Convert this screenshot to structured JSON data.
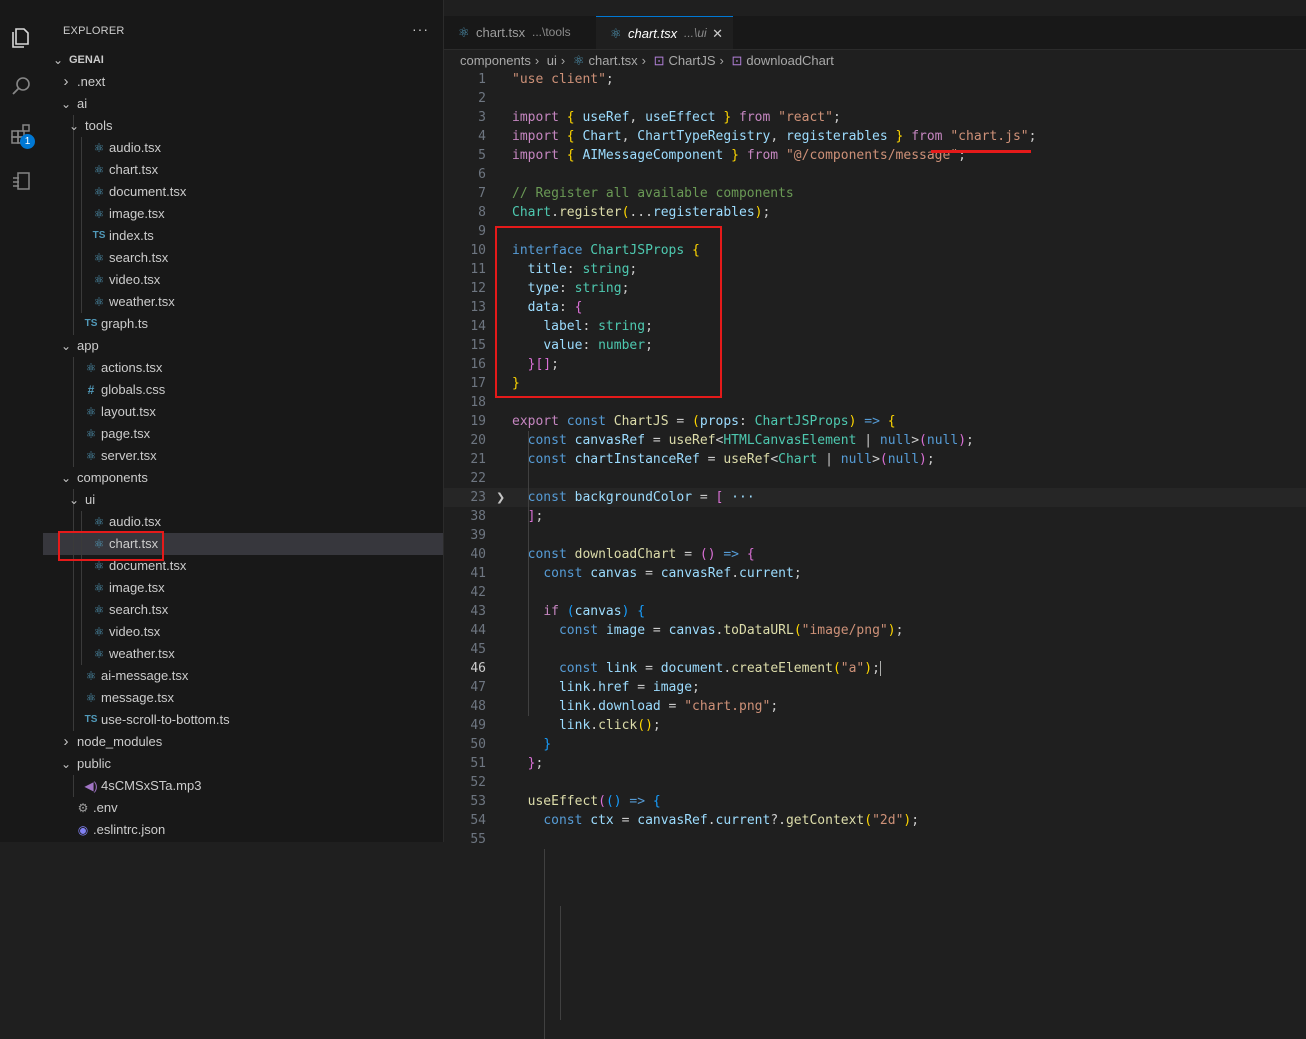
{
  "explorer": {
    "header": "EXPLORER",
    "more": "···",
    "badge": "1",
    "rows": [
      {
        "label": "GENAI",
        "depth": 0,
        "type": "root"
      },
      {
        "label": ".next",
        "depth": 1,
        "type": "folder-closed"
      },
      {
        "label": "ai",
        "depth": 1,
        "type": "folder-open"
      },
      {
        "label": "tools",
        "depth": 2,
        "type": "folder-open"
      },
      {
        "label": "audio.tsx",
        "depth": 3,
        "type": "react"
      },
      {
        "label": "chart.tsx",
        "depth": 3,
        "type": "react"
      },
      {
        "label": "document.tsx",
        "depth": 3,
        "type": "react"
      },
      {
        "label": "image.tsx",
        "depth": 3,
        "type": "react"
      },
      {
        "label": "index.ts",
        "depth": 3,
        "type": "ts"
      },
      {
        "label": "search.tsx",
        "depth": 3,
        "type": "react"
      },
      {
        "label": "video.tsx",
        "depth": 3,
        "type": "react"
      },
      {
        "label": "weather.tsx",
        "depth": 3,
        "type": "react"
      },
      {
        "label": "graph.ts",
        "depth": 2,
        "type": "ts"
      },
      {
        "label": "app",
        "depth": 1,
        "type": "folder-open"
      },
      {
        "label": "actions.tsx",
        "depth": 2,
        "type": "react"
      },
      {
        "label": "globals.css",
        "depth": 2,
        "type": "css"
      },
      {
        "label": "layout.tsx",
        "depth": 2,
        "type": "react"
      },
      {
        "label": "page.tsx",
        "depth": 2,
        "type": "react"
      },
      {
        "label": "server.tsx",
        "depth": 2,
        "type": "react"
      },
      {
        "label": "components",
        "depth": 1,
        "type": "folder-open"
      },
      {
        "label": "ui",
        "depth": 2,
        "type": "folder-open"
      },
      {
        "label": "audio.tsx",
        "depth": 3,
        "type": "react"
      },
      {
        "label": "chart.tsx",
        "depth": 3,
        "type": "react",
        "selected": true
      },
      {
        "label": "document.tsx",
        "depth": 3,
        "type": "react"
      },
      {
        "label": "image.tsx",
        "depth": 3,
        "type": "react"
      },
      {
        "label": "search.tsx",
        "depth": 3,
        "type": "react"
      },
      {
        "label": "video.tsx",
        "depth": 3,
        "type": "react"
      },
      {
        "label": "weather.tsx",
        "depth": 3,
        "type": "react"
      },
      {
        "label": "ai-message.tsx",
        "depth": 2,
        "type": "react"
      },
      {
        "label": "message.tsx",
        "depth": 2,
        "type": "react"
      },
      {
        "label": "use-scroll-to-bottom.ts",
        "depth": 2,
        "type": "ts"
      },
      {
        "label": "node_modules",
        "depth": 1,
        "type": "folder-closed"
      },
      {
        "label": "public",
        "depth": 1,
        "type": "folder-open"
      },
      {
        "label": "4sCMSxSTa.mp3",
        "depth": 2,
        "type": "mp3"
      },
      {
        "label": ".env",
        "depth": 1,
        "type": "env"
      },
      {
        "label": ".eslintrc.json",
        "depth": 1,
        "type": "eslint"
      }
    ]
  },
  "tabs": [
    {
      "name": "chart.tsx",
      "desc": "...\\tools",
      "active": false
    },
    {
      "name": "chart.tsx",
      "desc": "...\\ui",
      "active": true,
      "close": "✕"
    }
  ],
  "breadcrumb": [
    "components",
    "ui",
    "chart.tsx",
    "ChartJS",
    "downloadChart"
  ],
  "code_lines": [
    {
      "n": "1",
      "tokens": [
        [
          "s",
          "\"use client\""
        ],
        [
          "p",
          ";"
        ]
      ]
    },
    {
      "n": "2",
      "tokens": []
    },
    {
      "n": "3",
      "tokens": [
        [
          "c",
          "import"
        ],
        [
          "p",
          " "
        ],
        [
          "b1",
          "{"
        ],
        [
          "p",
          " "
        ],
        [
          "v",
          "useRef"
        ],
        [
          "p",
          ", "
        ],
        [
          "v",
          "useEffect"
        ],
        [
          "p",
          " "
        ],
        [
          "b1",
          "}"
        ],
        [
          "p",
          " "
        ],
        [
          "c",
          "from"
        ],
        [
          "p",
          " "
        ],
        [
          "s",
          "\"react\""
        ],
        [
          "p",
          ";"
        ]
      ]
    },
    {
      "n": "4",
      "tokens": [
        [
          "c",
          "import"
        ],
        [
          "p",
          " "
        ],
        [
          "b1",
          "{"
        ],
        [
          "p",
          " "
        ],
        [
          "v",
          "Chart"
        ],
        [
          "p",
          ", "
        ],
        [
          "v",
          "ChartTypeRegistry"
        ],
        [
          "p",
          ", "
        ],
        [
          "v",
          "registerables"
        ],
        [
          "p",
          " "
        ],
        [
          "b1",
          "}"
        ],
        [
          "p",
          " "
        ],
        [
          "c",
          "from"
        ],
        [
          "p",
          " "
        ],
        [
          "s",
          "\"chart.js\""
        ],
        [
          "p",
          ";"
        ]
      ]
    },
    {
      "n": "5",
      "tokens": [
        [
          "c",
          "import"
        ],
        [
          "p",
          " "
        ],
        [
          "b1",
          "{"
        ],
        [
          "p",
          " "
        ],
        [
          "v",
          "AIMessageComponent"
        ],
        [
          "p",
          " "
        ],
        [
          "b1",
          "}"
        ],
        [
          "p",
          " "
        ],
        [
          "c",
          "from"
        ],
        [
          "p",
          " "
        ],
        [
          "s",
          "\"@/components/message\""
        ],
        [
          "p",
          ";"
        ]
      ]
    },
    {
      "n": "6",
      "tokens": []
    },
    {
      "n": "7",
      "tokens": [
        [
          "cm",
          "// Register all available components"
        ]
      ]
    },
    {
      "n": "8",
      "tokens": [
        [
          "t",
          "Chart"
        ],
        [
          "p",
          "."
        ],
        [
          "f",
          "register"
        ],
        [
          "b1",
          "("
        ],
        [
          "p",
          "..."
        ],
        [
          "v",
          "registerables"
        ],
        [
          "b1",
          ")"
        ],
        [
          "p",
          ";"
        ]
      ]
    },
    {
      "n": "9",
      "tokens": []
    },
    {
      "n": "10",
      "tokens": [
        [
          "k",
          "interface"
        ],
        [
          "p",
          " "
        ],
        [
          "t",
          "ChartJSProps"
        ],
        [
          "p",
          " "
        ],
        [
          "b1",
          "{"
        ]
      ]
    },
    {
      "n": "11",
      "tokens": [
        [
          "p",
          "  "
        ],
        [
          "v",
          "title"
        ],
        [
          "p",
          ": "
        ],
        [
          "t",
          "string"
        ],
        [
          "p",
          ";"
        ]
      ]
    },
    {
      "n": "12",
      "tokens": [
        [
          "p",
          "  "
        ],
        [
          "v",
          "type"
        ],
        [
          "p",
          ": "
        ],
        [
          "t",
          "string"
        ],
        [
          "p",
          ";"
        ]
      ]
    },
    {
      "n": "13",
      "tokens": [
        [
          "p",
          "  "
        ],
        [
          "v",
          "data"
        ],
        [
          "p",
          ": "
        ],
        [
          "b2",
          "{"
        ]
      ]
    },
    {
      "n": "14",
      "tokens": [
        [
          "p",
          "    "
        ],
        [
          "v",
          "label"
        ],
        [
          "p",
          ": "
        ],
        [
          "t",
          "string"
        ],
        [
          "p",
          ";"
        ]
      ]
    },
    {
      "n": "15",
      "tokens": [
        [
          "p",
          "    "
        ],
        [
          "v",
          "value"
        ],
        [
          "p",
          ": "
        ],
        [
          "t",
          "number"
        ],
        [
          "p",
          ";"
        ]
      ]
    },
    {
      "n": "16",
      "tokens": [
        [
          "p",
          "  "
        ],
        [
          "b2",
          "}"
        ],
        [
          "b2",
          "[]"
        ],
        [
          "p",
          ";"
        ]
      ]
    },
    {
      "n": "17",
      "tokens": [
        [
          "b1",
          "}"
        ]
      ]
    },
    {
      "n": "18",
      "tokens": []
    },
    {
      "n": "19",
      "tokens": [
        [
          "c",
          "export"
        ],
        [
          "p",
          " "
        ],
        [
          "k",
          "const"
        ],
        [
          "p",
          " "
        ],
        [
          "f",
          "ChartJS"
        ],
        [
          "p",
          " = "
        ],
        [
          "b1",
          "("
        ],
        [
          "v",
          "props"
        ],
        [
          "p",
          ": "
        ],
        [
          "t",
          "ChartJSProps"
        ],
        [
          "b1",
          ")"
        ],
        [
          "p",
          " "
        ],
        [
          "k",
          "=>"
        ],
        [
          "p",
          " "
        ],
        [
          "b1",
          "{"
        ]
      ]
    },
    {
      "n": "20",
      "tokens": [
        [
          "p",
          "  "
        ],
        [
          "k",
          "const"
        ],
        [
          "p",
          " "
        ],
        [
          "v",
          "canvasRef"
        ],
        [
          "p",
          " = "
        ],
        [
          "f",
          "useRef"
        ],
        [
          "p",
          "<"
        ],
        [
          "t",
          "HTMLCanvasElement"
        ],
        [
          "p",
          " | "
        ],
        [
          "k",
          "null"
        ],
        [
          "p",
          ">"
        ],
        [
          "b2",
          "("
        ],
        [
          "k",
          "null"
        ],
        [
          "b2",
          ")"
        ],
        [
          "p",
          ";"
        ]
      ]
    },
    {
      "n": "21",
      "tokens": [
        [
          "p",
          "  "
        ],
        [
          "k",
          "const"
        ],
        [
          "p",
          " "
        ],
        [
          "v",
          "chartInstanceRef"
        ],
        [
          "p",
          " = "
        ],
        [
          "f",
          "useRef"
        ],
        [
          "p",
          "<"
        ],
        [
          "t",
          "Chart"
        ],
        [
          "p",
          " | "
        ],
        [
          "k",
          "null"
        ],
        [
          "p",
          ">"
        ],
        [
          "b2",
          "("
        ],
        [
          "k",
          "null"
        ],
        [
          "b2",
          ")"
        ],
        [
          "p",
          ";"
        ]
      ]
    },
    {
      "n": "22",
      "tokens": []
    },
    {
      "n": "23",
      "tokens": [
        [
          "p",
          "  "
        ],
        [
          "k",
          "const"
        ],
        [
          "p",
          " "
        ],
        [
          "v",
          "backgroundColor"
        ],
        [
          "p",
          " = "
        ],
        [
          "b2",
          "["
        ],
        [
          "p",
          " "
        ],
        [
          "v",
          "···"
        ]
      ],
      "fold": "❯",
      "hl": true
    },
    {
      "n": "38",
      "tokens": [
        [
          "p",
          "  "
        ],
        [
          "b2",
          "]"
        ],
        [
          "p",
          ";"
        ]
      ]
    },
    {
      "n": "39",
      "tokens": []
    },
    {
      "n": "40",
      "tokens": [
        [
          "p",
          "  "
        ],
        [
          "k",
          "const"
        ],
        [
          "p",
          " "
        ],
        [
          "f",
          "downloadChart"
        ],
        [
          "p",
          " = "
        ],
        [
          "b2",
          "("
        ],
        [
          "b2",
          ")"
        ],
        [
          "p",
          " "
        ],
        [
          "k",
          "=>"
        ],
        [
          "p",
          " "
        ],
        [
          "b2",
          "{"
        ]
      ]
    },
    {
      "n": "41",
      "tokens": [
        [
          "p",
          "    "
        ],
        [
          "k",
          "const"
        ],
        [
          "p",
          " "
        ],
        [
          "v",
          "canvas"
        ],
        [
          "p",
          " = "
        ],
        [
          "v",
          "canvasRef"
        ],
        [
          "p",
          "."
        ],
        [
          "v",
          "current"
        ],
        [
          "p",
          ";"
        ]
      ]
    },
    {
      "n": "42",
      "tokens": []
    },
    {
      "n": "43",
      "tokens": [
        [
          "p",
          "    "
        ],
        [
          "c",
          "if"
        ],
        [
          "p",
          " "
        ],
        [
          "b3",
          "("
        ],
        [
          "v",
          "canvas"
        ],
        [
          "b3",
          ")"
        ],
        [
          "p",
          " "
        ],
        [
          "b3",
          "{"
        ]
      ]
    },
    {
      "n": "44",
      "tokens": [
        [
          "p",
          "      "
        ],
        [
          "k",
          "const"
        ],
        [
          "p",
          " "
        ],
        [
          "v",
          "image"
        ],
        [
          "p",
          " = "
        ],
        [
          "v",
          "canvas"
        ],
        [
          "p",
          "."
        ],
        [
          "f",
          "toDataURL"
        ],
        [
          "b1",
          "("
        ],
        [
          "s",
          "\"image/png\""
        ],
        [
          "b1",
          ")"
        ],
        [
          "p",
          ";"
        ]
      ]
    },
    {
      "n": "45",
      "tokens": []
    },
    {
      "n": "46",
      "tokens": [
        [
          "p",
          "      "
        ],
        [
          "k",
          "const"
        ],
        [
          "p",
          " "
        ],
        [
          "v",
          "link"
        ],
        [
          "p",
          " = "
        ],
        [
          "v",
          "document"
        ],
        [
          "p",
          "."
        ],
        [
          "f",
          "createElement"
        ],
        [
          "b1",
          "("
        ],
        [
          "s",
          "\"a\""
        ],
        [
          "b1",
          ")"
        ],
        [
          "p",
          ";"
        ]
      ],
      "active": true,
      "cursor": true
    },
    {
      "n": "47",
      "tokens": [
        [
          "p",
          "      "
        ],
        [
          "v",
          "link"
        ],
        [
          "p",
          "."
        ],
        [
          "v",
          "href"
        ],
        [
          "p",
          " = "
        ],
        [
          "v",
          "image"
        ],
        [
          "p",
          ";"
        ]
      ]
    },
    {
      "n": "48",
      "tokens": [
        [
          "p",
          "      "
        ],
        [
          "v",
          "link"
        ],
        [
          "p",
          "."
        ],
        [
          "v",
          "download"
        ],
        [
          "p",
          " = "
        ],
        [
          "s",
          "\"chart.png\""
        ],
        [
          "p",
          ";"
        ]
      ]
    },
    {
      "n": "49",
      "tokens": [
        [
          "p",
          "      "
        ],
        [
          "v",
          "link"
        ],
        [
          "p",
          "."
        ],
        [
          "f",
          "click"
        ],
        [
          "b1",
          "("
        ],
        [
          "b1",
          ")"
        ],
        [
          "p",
          ";"
        ]
      ]
    },
    {
      "n": "50",
      "tokens": [
        [
          "p",
          "    "
        ],
        [
          "b3",
          "}"
        ]
      ]
    },
    {
      "n": "51",
      "tokens": [
        [
          "p",
          "  "
        ],
        [
          "b2",
          "}"
        ],
        [
          "p",
          ";"
        ]
      ]
    },
    {
      "n": "52",
      "tokens": []
    },
    {
      "n": "53",
      "tokens": [
        [
          "p",
          "  "
        ],
        [
          "f",
          "useEffect"
        ],
        [
          "b2",
          "("
        ],
        [
          "b3",
          "("
        ],
        [
          "b3",
          ")"
        ],
        [
          "p",
          " "
        ],
        [
          "k",
          "=>"
        ],
        [
          "p",
          " "
        ],
        [
          "b3",
          "{"
        ]
      ]
    },
    {
      "n": "54",
      "tokens": [
        [
          "p",
          "    "
        ],
        [
          "k",
          "const"
        ],
        [
          "p",
          " "
        ],
        [
          "v",
          "ctx"
        ],
        [
          "p",
          " = "
        ],
        [
          "v",
          "canvasRef"
        ],
        [
          "p",
          "."
        ],
        [
          "v",
          "current"
        ],
        [
          "p",
          "?."
        ],
        [
          "f",
          "getContext"
        ],
        [
          "b1",
          "("
        ],
        [
          "s",
          "\"2d\""
        ],
        [
          "b1",
          ")"
        ],
        [
          "p",
          ";"
        ]
      ]
    },
    {
      "n": "55",
      "tokens": []
    }
  ]
}
